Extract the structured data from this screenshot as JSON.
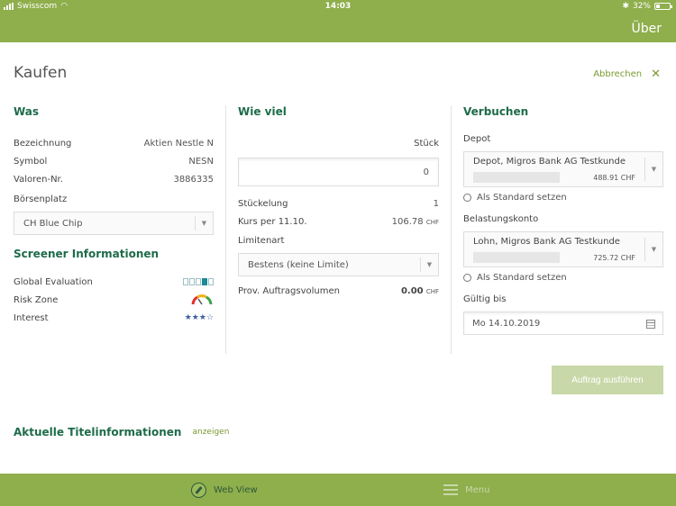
{
  "status_bar": {
    "carrier": "Swisscom",
    "time": "14:03",
    "battery": "32%"
  },
  "nav": {
    "right_label": "Über"
  },
  "page": {
    "title": "Kaufen",
    "cancel_label": "Abbrechen"
  },
  "was": {
    "heading": "Was",
    "rows": [
      {
        "label": "Bezeichnung",
        "value": "Aktien Nestle N"
      },
      {
        "label": "Symbol",
        "value": "NESN"
      },
      {
        "label": "Valoren-Nr.",
        "value": "3886335"
      }
    ],
    "exchange_label": "Börsenplatz",
    "exchange_value": "CH Blue Chip"
  },
  "screener": {
    "heading": "Screener Informationen",
    "global_evaluation_label": "Global Evaluation",
    "global_evaluation_level": 4,
    "global_evaluation_max": 5,
    "risk_zone_label": "Risk Zone",
    "interest_label": "Interest",
    "interest_stars": "★★★☆"
  },
  "wieviel": {
    "heading": "Wie viel",
    "qty_label": "Stück",
    "qty_value": "0",
    "stueckelung_label": "Stückelung",
    "stueckelung_value": "1",
    "kurs_label": "Kurs per 11.10.",
    "kurs_value": "106.78",
    "kurs_currency": "CHF",
    "limit_label": "Limitenart",
    "limit_value": "Bestens (keine Limite)",
    "volume_label": "Prov. Auftragsvolumen",
    "volume_value": "0.00",
    "volume_currency": "CHF"
  },
  "verbuchen": {
    "heading": "Verbuchen",
    "depot_label": "Depot",
    "depot_name": "Depot, Migros Bank AG Testkunde",
    "depot_amount": "488.91 CHF",
    "default_label": "Als Standard setzen",
    "konto_label": "Belastungskonto",
    "konto_name": "Lohn, Migros Bank AG Testkunde",
    "konto_amount": "725.72 CHF",
    "valid_label": "Gültig bis",
    "valid_value": "Mo  14.10.2019"
  },
  "execute_label": "Auftrag ausführen",
  "aktuell": {
    "title": "Aktuelle Titelinformationen",
    "link": "anzeigen"
  },
  "tabbar": {
    "tab1": "Web View",
    "tab2": "Menu"
  }
}
